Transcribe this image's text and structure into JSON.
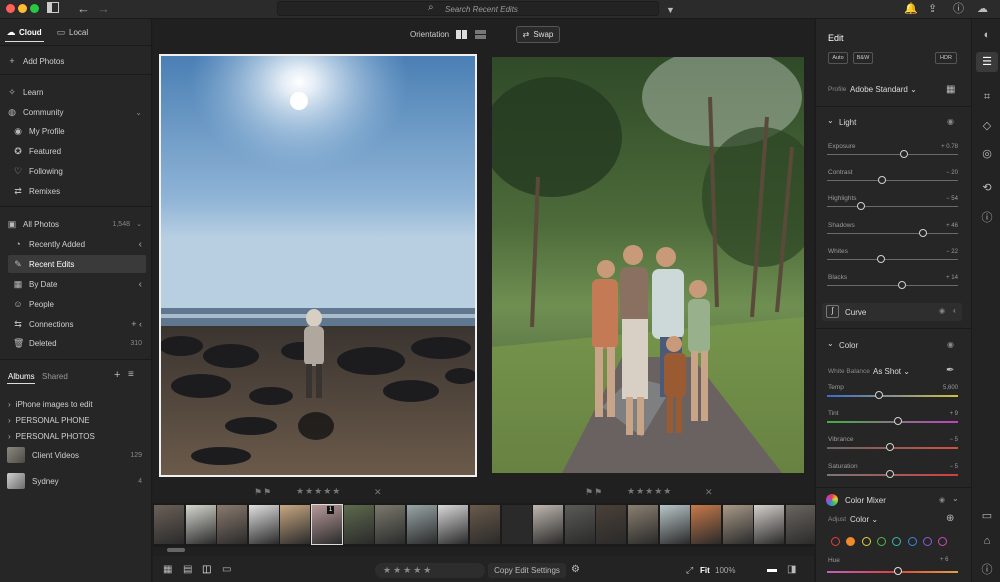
{
  "titlebar": {
    "search_placeholder": "Search Recent Edits",
    "colors": {
      "close": "#ff5f57",
      "minimize": "#febc2e",
      "maximize": "#28c840"
    }
  },
  "left_panel": {
    "tabs": {
      "cloud": "Cloud",
      "local": "Local"
    },
    "add_photos": "Add Photos",
    "learn": "Learn",
    "community": "Community",
    "community_items": [
      "My Profile",
      "Featured",
      "Following",
      "Remixes"
    ],
    "all_photos": {
      "label": "All Photos",
      "count": "1,548"
    },
    "library_items": [
      {
        "label": "Recently Added",
        "right": "‹"
      },
      {
        "label": "Recent Edits",
        "right": ""
      },
      {
        "label": "By Date",
        "right": "‹"
      },
      {
        "label": "People",
        "right": ""
      },
      {
        "label": "Connections",
        "right": "+ ‹"
      },
      {
        "label": "Deleted",
        "right": "310"
      }
    ],
    "album_tabs": {
      "albums": "Albums",
      "shared": "Shared"
    },
    "albums": [
      {
        "label": "iPhone images to edit",
        "count": ""
      },
      {
        "label": "PERSONAL PHONE",
        "count": ""
      },
      {
        "label": "PERSONAL PHOTOS",
        "count": ""
      },
      {
        "label": "Client Videos",
        "count": "129"
      },
      {
        "label": "Sydney",
        "count": "4"
      }
    ]
  },
  "center": {
    "orientation_label": "Orientation",
    "swap_label": "Swap",
    "filmstrip_badge": "1",
    "bottom": {
      "copy_edit_settings": "Copy Edit Settings",
      "fit": "Fit",
      "zoom": "100%"
    }
  },
  "right_panel": {
    "title": "Edit",
    "buttons": {
      "auto": "Auto",
      "bw": "B&W",
      "hdr": "HDR"
    },
    "profile": {
      "label": "Profile",
      "value": "Adobe Standard"
    },
    "light": {
      "title": "Light",
      "sliders": [
        {
          "label": "Exposure",
          "value": "+ 0.78",
          "pos": 0.59
        },
        {
          "label": "Contrast",
          "value": "− 20",
          "pos": 0.42
        },
        {
          "label": "Highlights",
          "value": "− 54",
          "pos": 0.26
        },
        {
          "label": "Shadows",
          "value": "+ 46",
          "pos": 0.73
        },
        {
          "label": "Whites",
          "value": "− 22",
          "pos": 0.41
        },
        {
          "label": "Blacks",
          "value": "+ 14",
          "pos": 0.57
        }
      ]
    },
    "curve": "Curve",
    "color": {
      "title": "Color",
      "white_balance_label": "White Balance",
      "white_balance_value": "As Shot",
      "sliders": [
        {
          "label": "Temp",
          "value": "5,600",
          "pos": 0.4
        },
        {
          "label": "Tint",
          "value": "+ 9",
          "pos": 0.54
        },
        {
          "label": "Vibrance",
          "value": "− 5",
          "pos": 0.48
        },
        {
          "label": "Saturation",
          "value": "− 5",
          "pos": 0.48
        }
      ]
    },
    "color_mixer": {
      "title": "Color Mixer",
      "adjust_label": "Adjust",
      "adjust_value": "Color",
      "hue_label": "Hue",
      "hue_value": "+ 6"
    },
    "mixer_colors": [
      "#e0403a",
      "#f08a2a",
      "#e8d23a",
      "#53b848",
      "#3ab8a8",
      "#3a88e0",
      "#8a5ae0",
      "#d04ab8"
    ]
  }
}
